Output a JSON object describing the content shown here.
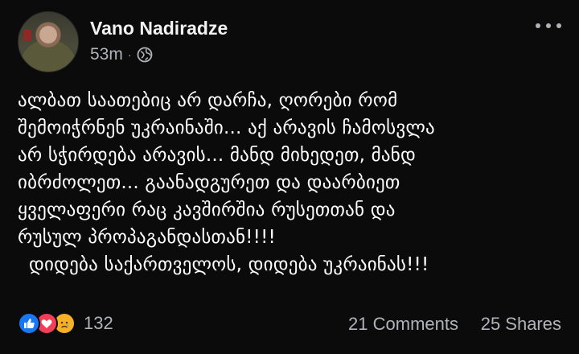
{
  "post": {
    "author": "Vano Nadiradze",
    "time": "53m",
    "separator": "·",
    "privacy_icon": "globe-icon",
    "menu_icon": "more-options-icon",
    "text_lines": [
      "ალბათ საათებიც არ დარჩა, ღორები რომ",
      "შემოიჭრნენ უკრაინაში... აქ არავის ჩამოსვლა",
      "არ სჭირდება არავის... მანდ მიხედეთ,  მანდ",
      "იბრძოლეთ... გაანადგურეთ და დაარბიეთ",
      "ყველაფერი რაც კავშირშია რუსეთთან და",
      "რუსულ პროპაგანდასთან!!!!",
      "დიდება საქართველოს,  დიდება უკრაინას!!!"
    ]
  },
  "footer": {
    "reaction_icons": [
      "like-icon",
      "love-icon",
      "sad-icon"
    ],
    "reaction_count": "132",
    "comments": "21 Comments",
    "shares": "25 Shares"
  },
  "colors": {
    "background": "#0b0b0c",
    "like": "#1877f2",
    "love": "#f33e58",
    "sad": "#f7b125",
    "secondary_text": "#b0b3b8"
  }
}
